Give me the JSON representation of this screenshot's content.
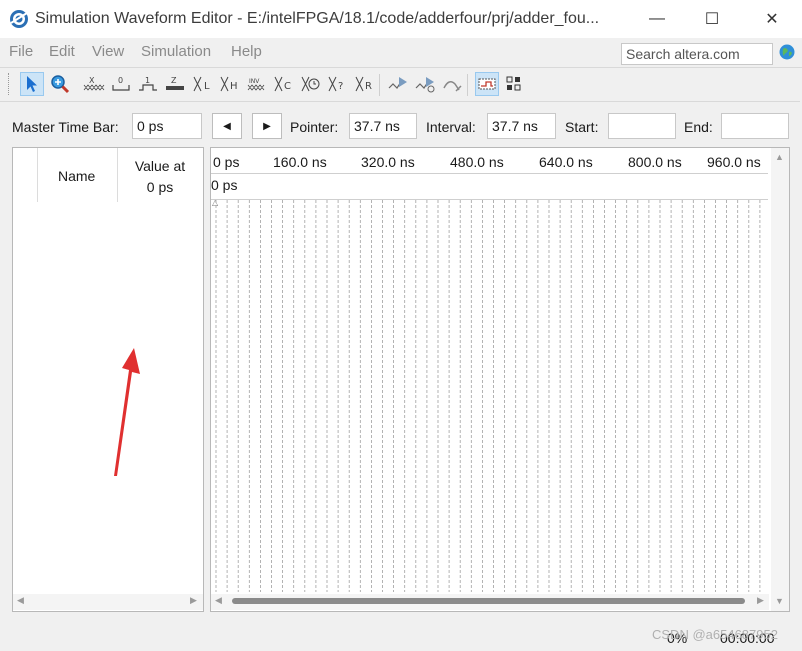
{
  "window": {
    "title": "Simulation Waveform Editor - E:/intelFPGA/18.1/code/adderfour/prj/adder_fou...",
    "minimize_glyph": "—",
    "maximize_glyph": "☐",
    "close_glyph": "✕"
  },
  "menu": {
    "file": "File",
    "edit": "Edit",
    "view": "View",
    "simulation": "Simulation",
    "help": "Help"
  },
  "search": {
    "value": "Search altera.com"
  },
  "toolbar": {
    "icons": [
      "selection-tool-icon",
      "zoom-tool-icon",
      "forcing-unknown-icon",
      "forcing-low-icon",
      "forcing-high-icon",
      "high-impedance-icon",
      "weak-low-icon",
      "weak-high-icon",
      "invert-icon",
      "count-value-icon",
      "clock-value-icon",
      "dont-care-icon",
      "random-value-icon",
      "run-functional-sim-icon",
      "run-timing-sim-icon",
      "generate-netlist-icon",
      "snap-to-grid-icon",
      "sort-icon"
    ],
    "labels": {
      "forcing_unknown": "X",
      "forcing_low": "0",
      "forcing_high": "1",
      "high_z": "Z",
      "weak_low": "L",
      "weak_high": "H",
      "invert": "INV",
      "count": "C",
      "clock": "",
      "dont_care": "?",
      "random": "R"
    }
  },
  "controls": {
    "master_time_bar_label": "Master Time Bar:",
    "master_time_bar_value": "0 ps",
    "pointer_label": "Pointer:",
    "pointer_value": "37.7 ns",
    "interval_label": "Interval:",
    "interval_value": "37.7 ns",
    "start_label": "Start:",
    "start_value": "",
    "end_label": "End:",
    "end_value": ""
  },
  "signal_table": {
    "name_header": "Name",
    "value_header_line1": "Value at",
    "value_header_line2": "0 ps"
  },
  "waveform": {
    "time_ticks": [
      "0 ps",
      "160.0 ns",
      "320.0 ns",
      "480.0 ns",
      "640.0 ns",
      "800.0 ns",
      "960.0 ns"
    ],
    "cursor_label": "0 ps"
  },
  "status": {
    "progress": "0%",
    "elapsed": "00:00:00"
  },
  "watermark": "CSDN @a654687952",
  "colors": {
    "accent": "#0078d7",
    "arrow": "#e03030",
    "grid": "#a0a0a0"
  }
}
